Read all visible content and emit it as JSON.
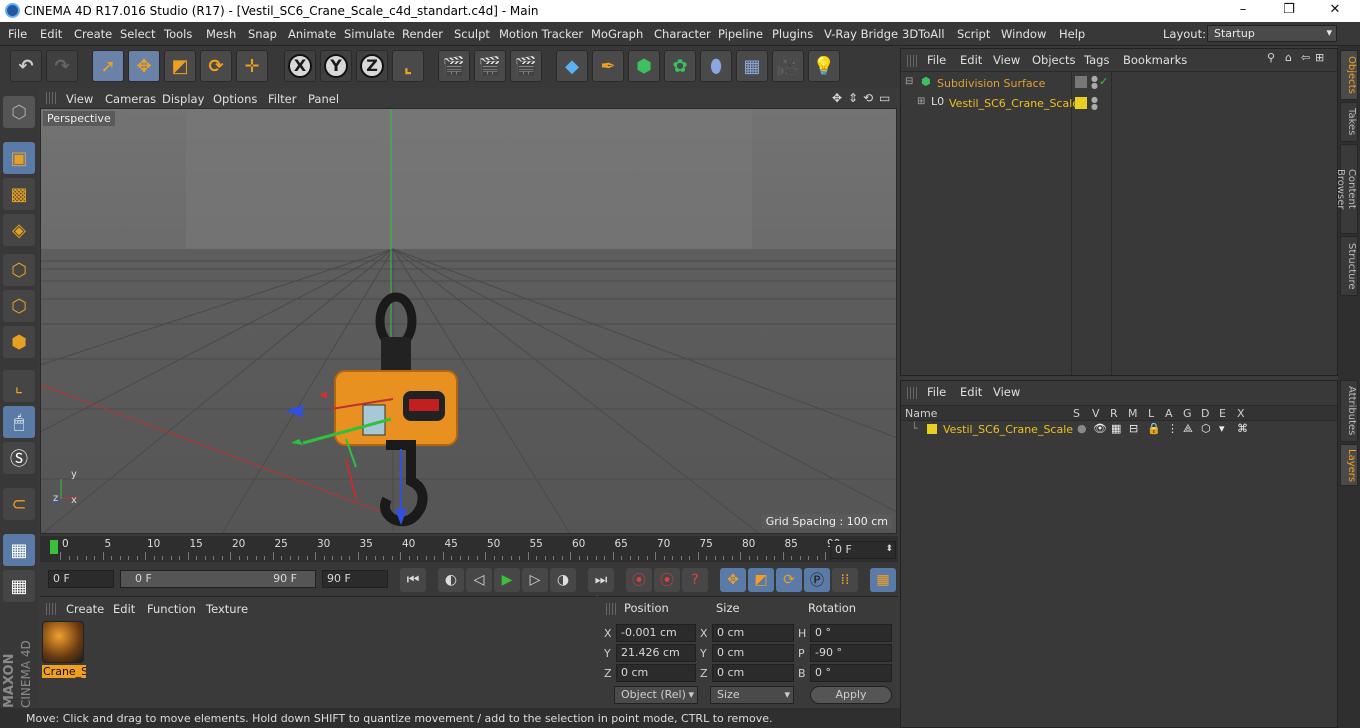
{
  "window": {
    "title": "CINEMA 4D R17.016 Studio (R17) - [Vestil_SC6_Crane_Scale_c4d_standart.c4d] - Main",
    "minimize": "–",
    "maximize": "❐",
    "close": "✕"
  },
  "menubar": {
    "items": [
      "File",
      "Edit",
      "Create",
      "Select",
      "Tools",
      "Mesh",
      "Snap",
      "Animate",
      "Simulate",
      "Render",
      "Sculpt",
      "Motion Tracker",
      "MoGraph",
      "Character",
      "Pipeline",
      "Plugins",
      "V-Ray Bridge",
      "3DToAll",
      "Script",
      "Window",
      "Help"
    ],
    "layout_label": "Layout:",
    "layout_value": "Startup"
  },
  "viewport": {
    "menu": [
      "View",
      "Cameras",
      "Display",
      "Options",
      "Filter",
      "Panel"
    ],
    "camera_label": "Perspective",
    "grid_spacing": "Grid Spacing : 100 cm",
    "axis_y": "y",
    "axis_z": "z",
    "axis_x": "x"
  },
  "timeline": {
    "ticks": [
      "0",
      "5",
      "10",
      "15",
      "20",
      "25",
      "30",
      "35",
      "40",
      "45",
      "50",
      "55",
      "60",
      "65",
      "70",
      "75",
      "80",
      "85",
      "90"
    ],
    "current_frame": "0 F"
  },
  "transport": {
    "start_field": "0 F",
    "range_start": "0 F",
    "range_end": "90 F",
    "end_field": "90 F"
  },
  "material_panel": {
    "menu": [
      "Create",
      "Edit",
      "Function",
      "Texture"
    ],
    "material_name": "Crane_S"
  },
  "coordinates": {
    "headers": {
      "position": "Position",
      "size": "Size",
      "rotation": "Rotation"
    },
    "rows": [
      {
        "axis": "X",
        "pos": "-0.001 cm",
        "size_axis": "X",
        "size": "0 cm",
        "rot_axis": "H",
        "rot": "0 °"
      },
      {
        "axis": "Y",
        "pos": "21.426 cm",
        "size_axis": "Y",
        "size": "0 cm",
        "rot_axis": "P",
        "rot": "-90 °"
      },
      {
        "axis": "Z",
        "pos": "0 cm",
        "size_axis": "Z",
        "size": "0 cm",
        "rot_axis": "B",
        "rot": "0 °"
      }
    ],
    "mode_select": "Object (Rel)",
    "size_select": "Size",
    "apply": "Apply"
  },
  "object_manager": {
    "menu": [
      "File",
      "Edit",
      "View",
      "Objects",
      "Tags",
      "Bookmarks"
    ],
    "items": [
      {
        "name": "Subdivision Surface",
        "color": "#e0a030"
      },
      {
        "name": "Vestil_SC6_Crane_Scale",
        "color": "#f0c020"
      }
    ]
  },
  "layer_manager": {
    "menu": [
      "File",
      "Edit",
      "View"
    ],
    "columns": [
      "Name",
      "S",
      "V",
      "R",
      "M",
      "L",
      "A",
      "G",
      "D",
      "E",
      "X"
    ],
    "layer_name": "Vestil_SC6_Crane_Scale"
  },
  "side_tabs": [
    "Objects",
    "Takes",
    "Content Browser",
    "Structure",
    "Attributes",
    "Layers"
  ],
  "statusbar": {
    "text": "Move: Click and drag to move elements. Hold down SHIFT to quantize movement / add to the selection in point mode, CTRL to remove."
  },
  "branding": {
    "maxon": "MAXON",
    "product": "CINEMA 4D"
  },
  "colors": {
    "accent": "#f0a020",
    "selection": "#5a7ba8",
    "background": "#3a3a3a"
  }
}
